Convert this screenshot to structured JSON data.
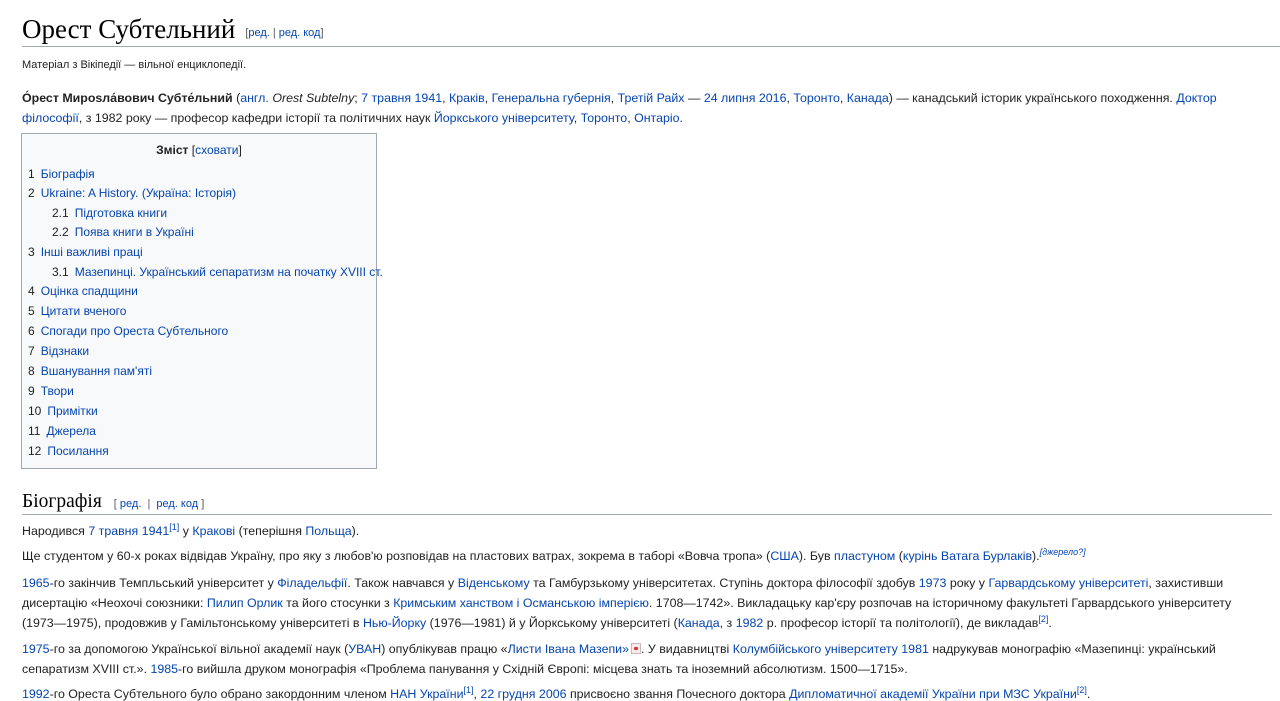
{
  "header": {
    "title": "Орест Субтельний",
    "edit": "ред.",
    "edit_code": "ред. код"
  },
  "tagline": "Матеріал з Вікіпедії — вільної енциклопедії.",
  "intro": {
    "name": "О́рест Мирosла́вович Субте́льний",
    "lang": "англ.",
    "orig_name": "Orest Subtelny",
    "birth_date": "7 травня 1941",
    "birth_city": "Краків",
    "province": "Генеральна губернія",
    "reich": "Третій Райх",
    "dash": "—",
    "death_date": "24 липня 2016",
    "death_city": "Торонто",
    "country": "Канада",
    "desc1": ") — канадський історик українського походження.",
    "doctor_1": "Доктор",
    "doctor_2": "філософії",
    "since": ", з 1982 року — професор кафедри історії та політичних наук",
    "york": "Йоркського університету",
    "toronto": "Торонто",
    "ontario": "Онтаріо"
  },
  "toc": {
    "title": "Зміст",
    "hide": "сховати",
    "items": [
      {
        "num": "1",
        "label": "Біографія"
      },
      {
        "num": "2",
        "label": "Ukraine: A History. (Україна: Історія)"
      },
      {
        "num": "2.1",
        "label": "Підготовка книги"
      },
      {
        "num": "2.2",
        "label": "Поява книги в Україні"
      },
      {
        "num": "3",
        "label": "Інші важливі праці"
      },
      {
        "num": "3.1",
        "label": "Мазепинці. Український сепаратизм на початку XVIII ст."
      },
      {
        "num": "4",
        "label": "Оцінка спадщини"
      },
      {
        "num": "5",
        "label": "Цитати вченого"
      },
      {
        "num": "6",
        "label": "Спогади про Ореста Субтельного"
      },
      {
        "num": "7",
        "label": "Відзнаки"
      },
      {
        "num": "8",
        "label": "Вшанування пам'яті"
      },
      {
        "num": "9",
        "label": "Твори"
      },
      {
        "num": "10",
        "label": "Примітки"
      },
      {
        "num": "11",
        "label": "Джерела"
      },
      {
        "num": "12",
        "label": "Посилання"
      }
    ]
  },
  "biography": {
    "heading": "Біографія",
    "p1": {
      "a": "Народився",
      "date": "7 травня 1941",
      "ref": "[1]",
      "b": "у",
      "city": "Кракові",
      "c": "(теперішня",
      "country": "Польща",
      "d": ")."
    },
    "p2": {
      "a": "Ще студентом у 60-х роках відвідав Україну, про яку з любов'ю розповідав на пластових ватрах, зокрема в таборі «Вовча тропа» (",
      "usa": "США",
      "b": "). Був",
      "plast": "пластуном",
      "c": "(",
      "kurin": "курінь Ватага Бурлаків",
      "d": ").",
      "source": "[джерело?]"
    },
    "p3": {
      "y1965": "1965",
      "a": "-го закінчив Темпльський університет у",
      "phil": "Філадельфії",
      "b": ". Також навчався у",
      "vienna": "Віденському",
      "c": "та Гамбурзькому університетах. Ступінь доктора філософії здобув",
      "y1973": "1973",
      "d": "року у",
      "harvard": "Гарвардському університеті",
      "e": ", захистивши",
      "f": "дисертацію «Неохочі союзники:",
      "orlyk": "Пилип Орлик",
      "g": "та його стосунки з",
      "crimea": "Кримським ханством і Османською імперією",
      "h": ". 1708—1742». Викладацьку кар'єру розпочав на історичному факультеті Гарвардського університету",
      "i": "(1973—1975), продовжив у Гамільтонському університеті в",
      "ny": "Нью-Йорку",
      "j": "(1976—1981) й у Йоркському університеті (",
      "canada": "Канада",
      "k": ", з",
      "y1982": "1982",
      "l": "р. професор історії та політології), де викладав",
      "ref": "[2]",
      "m": "."
    },
    "p4": {
      "y1975": "1975",
      "a": "-го за допомогою Української вільної академії наук (",
      "uvan": "УВАН",
      "b": ") опублікував працю «",
      "mazepa": "Листи Івана Мазепи»",
      "c": ". У видавництві",
      "columbia": "Колумбійського університету 1981",
      "d": "надрукував монографію «Мазепинці: український",
      "e": "сепаратизм XVIII ст.».",
      "y1985": "1985",
      "f": "-го вийшла друком монографія «Проблема панування у Східній Європі: місцева знать та іноземний абсолютизм. 1500—1715»."
    },
    "p5": {
      "y1992": "1992",
      "a": "-го Ореста Субтельного було обрано закордонним членом",
      "nan": "НАН України",
      "ref1": "[1]",
      "b": ",",
      "date": "22 грудня 2006",
      "c": "присвоєно звання Почесного доктора",
      "academy": "Дипломатичної академії України при МЗС України",
      "ref2": "[2]",
      "d": "."
    }
  }
}
